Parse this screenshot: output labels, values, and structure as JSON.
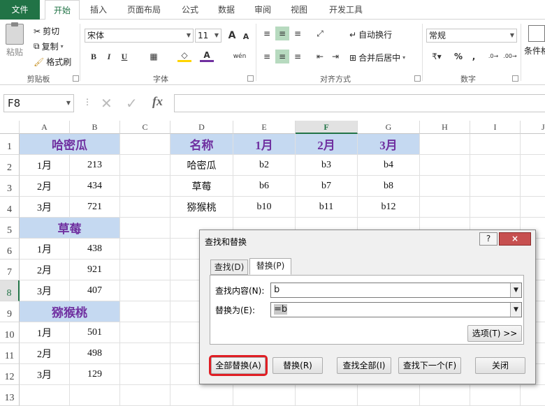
{
  "tabs": [
    {
      "label": "文件"
    },
    {
      "label": "开始"
    },
    {
      "label": "插入"
    },
    {
      "label": "页面布局"
    },
    {
      "label": "公式"
    },
    {
      "label": "数据"
    },
    {
      "label": "审阅"
    },
    {
      "label": "视图"
    },
    {
      "label": "开发工具"
    }
  ],
  "ribbon": {
    "clipboard": {
      "paste": "粘贴",
      "cut": "剪切",
      "copy": "复制",
      "format_painter": "格式刷",
      "label": "剪贴板"
    },
    "font": {
      "name": "宋体",
      "size": "11",
      "bold": "B",
      "italic": "I",
      "underline": "U",
      "label": "字体",
      "grow": "A",
      "shrink": "A",
      "phonetic": "wén"
    },
    "alignment": {
      "wrap": "自动换行",
      "merge": "合并后居中",
      "label": "对齐方式"
    },
    "number": {
      "format": "常规",
      "percent": "%",
      "comma": ",",
      "label": "数字"
    },
    "styles": {
      "conditional": "条件格"
    }
  },
  "formula_bar": {
    "name_box": "F8",
    "fx": "fx",
    "formula": ""
  },
  "columns": [
    "A",
    "B",
    "C",
    "D",
    "E",
    "F",
    "G",
    "H",
    "I",
    "J"
  ],
  "rows": [
    "1",
    "2",
    "3",
    "4",
    "5",
    "6",
    "7",
    "8",
    "9",
    "10",
    "11",
    "12",
    "13"
  ],
  "cells": {
    "A1": "哈密瓜",
    "A2": "1月",
    "B2": "213",
    "A3": "2月",
    "B3": "434",
    "A4": "3月",
    "B4": "721",
    "A5": "草莓",
    "A6": "1月",
    "B6": "438",
    "A7": "2月",
    "B7": "921",
    "A8": "3月",
    "B8": "407",
    "A9": "猕猴桃",
    "A10": "1月",
    "B10": "501",
    "A11": "2月",
    "B11": "498",
    "A12": "3月",
    "B12": "129",
    "D1": "名称",
    "E1": "1月",
    "F1": "2月",
    "G1": "3月",
    "D2": "哈密瓜",
    "E2": "b2",
    "F2": "b3",
    "G2": "b4",
    "D3": "草莓",
    "E3": "b6",
    "F3": "b7",
    "G3": "b8",
    "D4": "猕猴桃",
    "E4": "b10",
    "F4": "b11",
    "G4": "b12"
  },
  "dialog": {
    "title": "查找和替换",
    "help": "?",
    "close": "×",
    "tab_find": "查找(D)",
    "tab_replace": "替换(P)",
    "find_label": "查找内容(N):",
    "find_value": "b",
    "replace_label": "替换为(E):",
    "replace_value": "=b",
    "options": "选项(T) >>",
    "replace_all": "全部替换(A)",
    "replace": "替换(R)",
    "find_all": "查找全部(I)",
    "find_next": "查找下一个(F)",
    "close_btn": "关闭"
  },
  "colors": {
    "accent": "#217346",
    "header_fill": "#c5d9f1",
    "header_text": "#7030a0",
    "highlight": "#e01e24"
  }
}
